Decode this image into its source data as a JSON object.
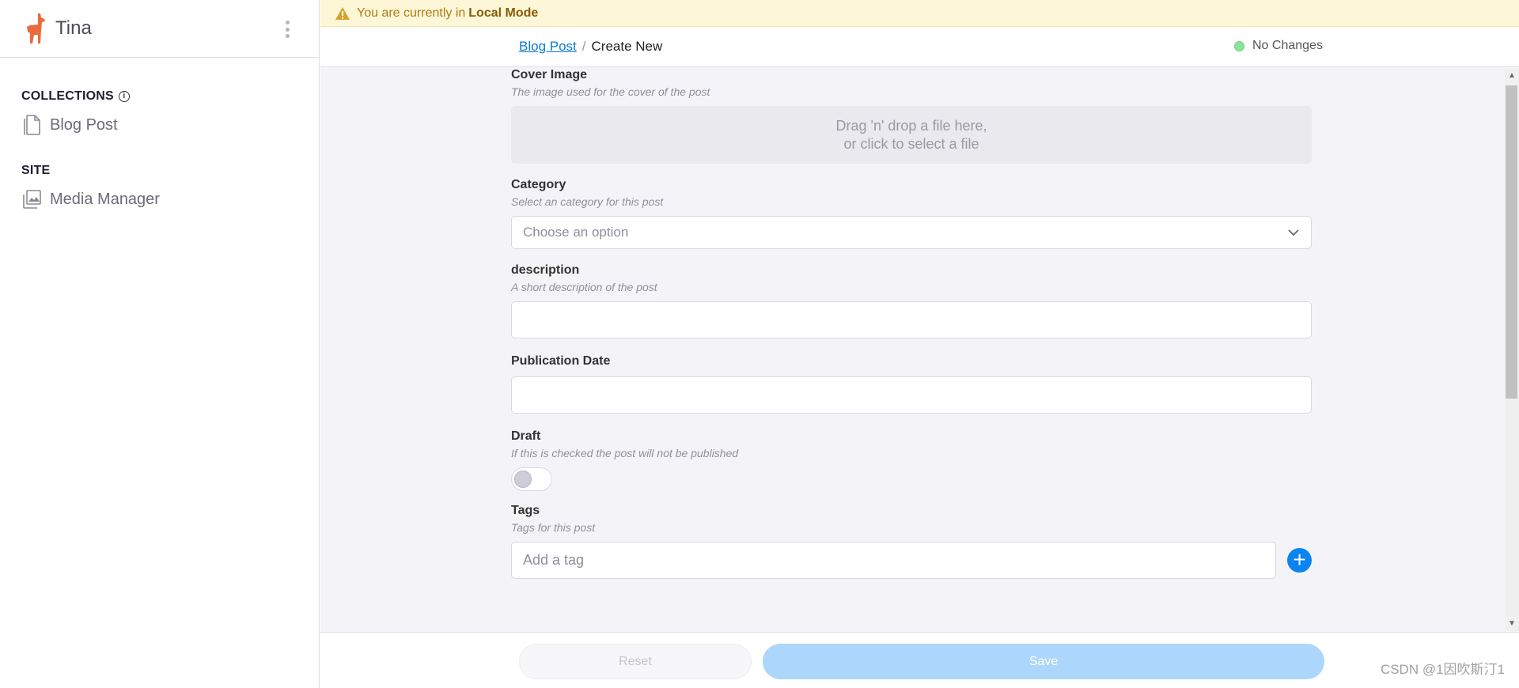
{
  "sidebar": {
    "brand_name": "Tina",
    "collections_heading": "COLLECTIONS",
    "collections": [
      {
        "label": "Blog Post",
        "icon": "document-icon"
      }
    ],
    "site_heading": "SITE",
    "site_items": [
      {
        "label": "Media Manager",
        "icon": "image-icon"
      }
    ]
  },
  "banner": {
    "prefix": "You are currently in",
    "mode": "Local Mode",
    "icon": "warning-icon"
  },
  "topbar": {
    "breadcrumb_link": "Blog Post",
    "separator": "/",
    "breadcrumb_current": "Create New",
    "status_text": "No Changes",
    "status_color": "#8ee39c"
  },
  "form": {
    "cover_image": {
      "label": "Cover Image",
      "description": "The image used for the cover of the post",
      "drop_line1": "Drag 'n' drop a file here,",
      "drop_line2": "or click to select a file"
    },
    "category": {
      "label": "Category",
      "description": "Select an category for this post",
      "placeholder": "Choose an option"
    },
    "description": {
      "label": "description",
      "description": "A short description of the post",
      "value": ""
    },
    "publication_date": {
      "label": "Publication Date",
      "value": ""
    },
    "draft": {
      "label": "Draft",
      "description": "If this is checked the post will not be published",
      "checked": false
    },
    "tags": {
      "label": "Tags",
      "description": "Tags for this post",
      "placeholder": "Add a tag"
    }
  },
  "footer": {
    "reset_label": "Reset",
    "save_label": "Save"
  },
  "watermark": "CSDN @1因吹斯汀1",
  "colors": {
    "accent": "#0a84f0",
    "brand": "#ec6a3b",
    "save_disabled": "#acd6fb"
  }
}
